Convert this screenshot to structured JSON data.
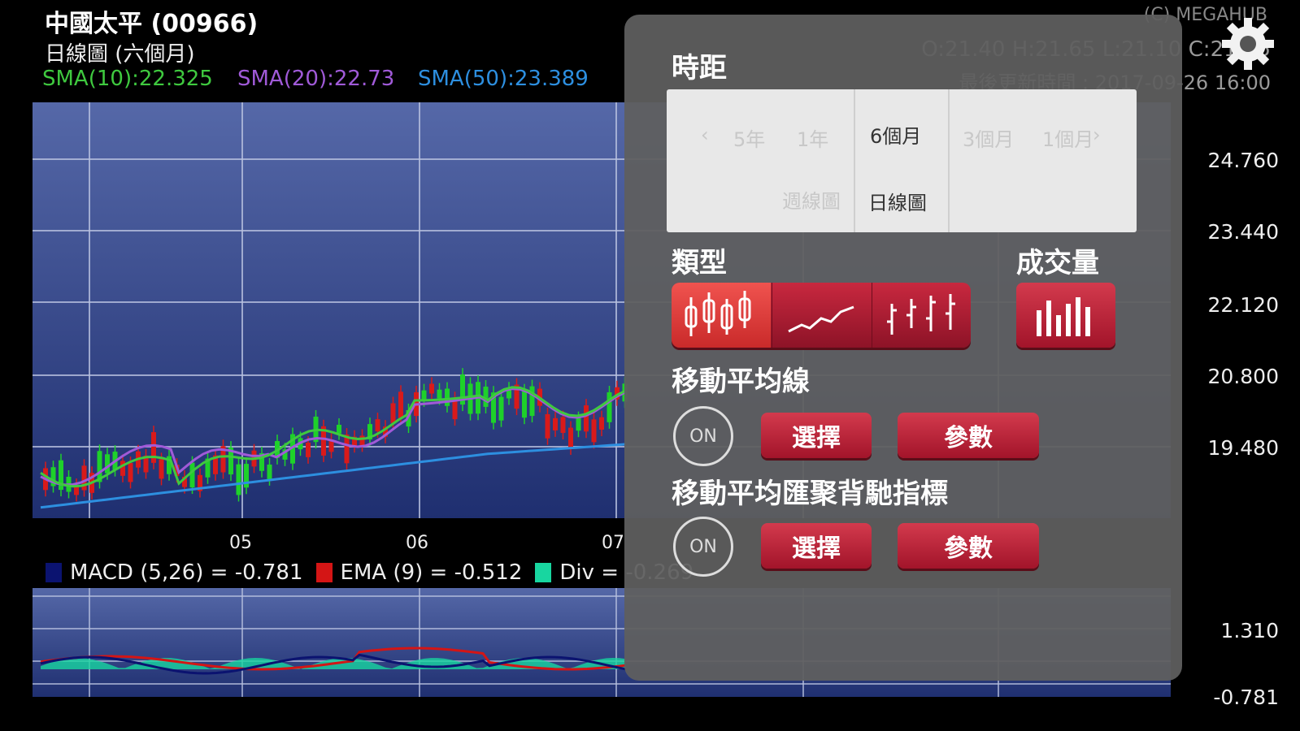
{
  "header": {
    "title": "中國太平 (00966)",
    "subtitle": "日線圖 (六個月)",
    "sma10": "SMA(10):22.325",
    "sma20": "SMA(20):22.73",
    "sma50": "SMA(50):23.389",
    "copyright": "(C) MEGAHUB",
    "ohlc": "O:21.40  H:21.65  L:21.10  C:21.35",
    "update_time": "最後更新時間 : 2017-09-26 16:00"
  },
  "axes": {
    "price_ticks": [
      "24.760",
      "23.440",
      "22.120",
      "20.800",
      "19.480"
    ],
    "month_ticks": [
      "05",
      "06",
      "07"
    ],
    "macd_ticks": [
      "1.310",
      "-0.781"
    ]
  },
  "macd_legend": {
    "macd": "MACD (5,26) = -0.781",
    "ema": "EMA (9) = -0.512",
    "div": "Div = -0.269"
  },
  "panel": {
    "period_title": "時距",
    "period_top": [
      "5年",
      "1年",
      "6個月",
      "3個月",
      "1個月"
    ],
    "period_bottom": [
      "週線圖",
      "日線圖"
    ],
    "period_selected": "6個月",
    "type_title": "類型",
    "volume_title": "成交量",
    "ma_title": "移動平均線",
    "macd_title": "移動平均匯聚背馳指標",
    "on_label": "ON",
    "select_label": "選擇",
    "param_label": "參數"
  },
  "colors": {
    "chart_bg": "#2c3e86",
    "grid": "#b9c2e0",
    "up": "#1ed12a",
    "down": "#d91a1a",
    "sma10": "#3fc93f",
    "sma20": "#a05ad8",
    "sma50": "#2d8fe0",
    "accent_red": "#b51d33"
  },
  "icons": [
    "gear-icon",
    "candlestick-icon",
    "line-chart-icon",
    "ohlc-bar-icon",
    "volume-bars-icon"
  ]
}
